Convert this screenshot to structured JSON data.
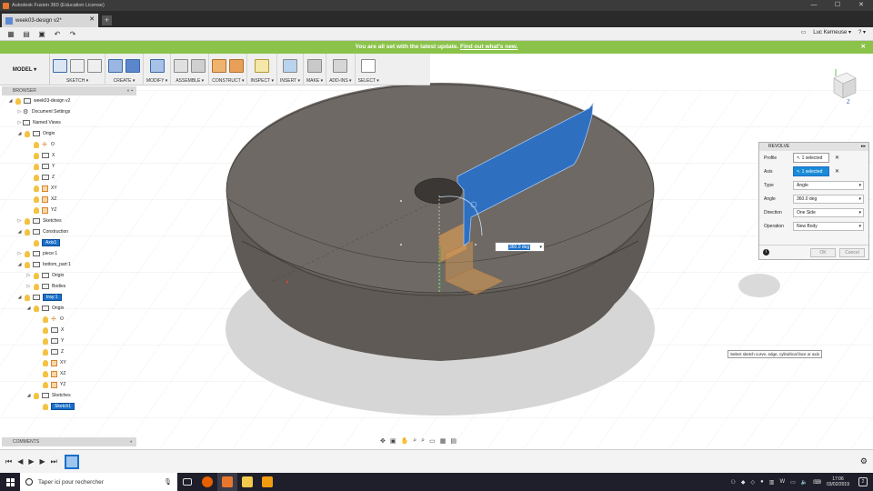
{
  "window": {
    "title": "Autodesk Fusion 360 (Education License)",
    "controls": [
      "—",
      "☐",
      "✕"
    ]
  },
  "tabs": {
    "doc_tab_label": "week03-design v2*",
    "close": "✕",
    "new_tab": "+"
  },
  "quick_access": {
    "user_name": "Luc Kerneuse ▾",
    "help": "? ▾"
  },
  "notification": {
    "text": "You are all set with the latest update.",
    "link": "Find out what's new.",
    "close": "✕"
  },
  "toolbar": {
    "workspace": "MODEL ▾",
    "groups": [
      {
        "label": "SKETCH ▾"
      },
      {
        "label": "CREATE ▾"
      },
      {
        "label": "MODIFY ▾"
      },
      {
        "label": "ASSEMBLE ▾"
      },
      {
        "label": "CONSTRUCT ▾"
      },
      {
        "label": "INSPECT ▾"
      },
      {
        "label": "INSERT ▾"
      },
      {
        "label": "MAKE ▾"
      },
      {
        "label": "ADD-INS ▾"
      },
      {
        "label": "SELECT ▾"
      }
    ]
  },
  "browser": {
    "title": "BROWSER",
    "collapse": "◐ ▪",
    "items": [
      {
        "label": "week03-design v2"
      },
      {
        "label": "Document Settings"
      },
      {
        "label": "Named Views"
      },
      {
        "label": "Origin"
      },
      {
        "label": "O"
      },
      {
        "label": "X"
      },
      {
        "label": "Y"
      },
      {
        "label": "Z"
      },
      {
        "label": "XY"
      },
      {
        "label": "XZ"
      },
      {
        "label": "YZ"
      },
      {
        "label": "Sketches"
      },
      {
        "label": "Construction"
      },
      {
        "label": "Axis1"
      },
      {
        "label": "piece:1"
      },
      {
        "label": "bottom_part:1"
      },
      {
        "label": "Origin"
      },
      {
        "label": "Bodies"
      },
      {
        "label": "tray:1"
      },
      {
        "label": "Origin"
      },
      {
        "label": "O"
      },
      {
        "label": "X"
      },
      {
        "label": "Y"
      },
      {
        "label": "Z"
      },
      {
        "label": "XY"
      },
      {
        "label": "XZ"
      },
      {
        "label": "YZ"
      },
      {
        "label": "Sketches"
      },
      {
        "label": "Sketch1"
      }
    ]
  },
  "comments": {
    "title": "COMMENTS",
    "ctl": "◐"
  },
  "revolve": {
    "title": "REVOLVE",
    "ctl": "▸▸",
    "profile_label": "Profile",
    "profile_value": "1 selected",
    "axis_label": "Axis",
    "axis_value": "1 selected",
    "type_label": "Type",
    "type_value": "Angle",
    "angle_label": "Angle",
    "angle_value": "360.0 deg",
    "direction_label": "Direction",
    "direction_value": "One Side",
    "operation_label": "Operation",
    "operation_value": "New Body",
    "ok": "OK",
    "cancel": "Cancel",
    "info": "i"
  },
  "viewport": {
    "angle_input": "360.0 deg",
    "tooltip": "Select sketch curve, edge, cylindrical face or axis",
    "viewcube_label": "Z"
  },
  "taskbar": {
    "search_placeholder": "Taper ici pour rechercher",
    "time": "17:06",
    "date": "03/02/2019",
    "notif_count": "2"
  },
  "colors": {
    "accent": "#1a6fc9",
    "notification": "#8bc34a",
    "profile_blue": "#2f6fc0",
    "model_gray": "#6b6660"
  }
}
